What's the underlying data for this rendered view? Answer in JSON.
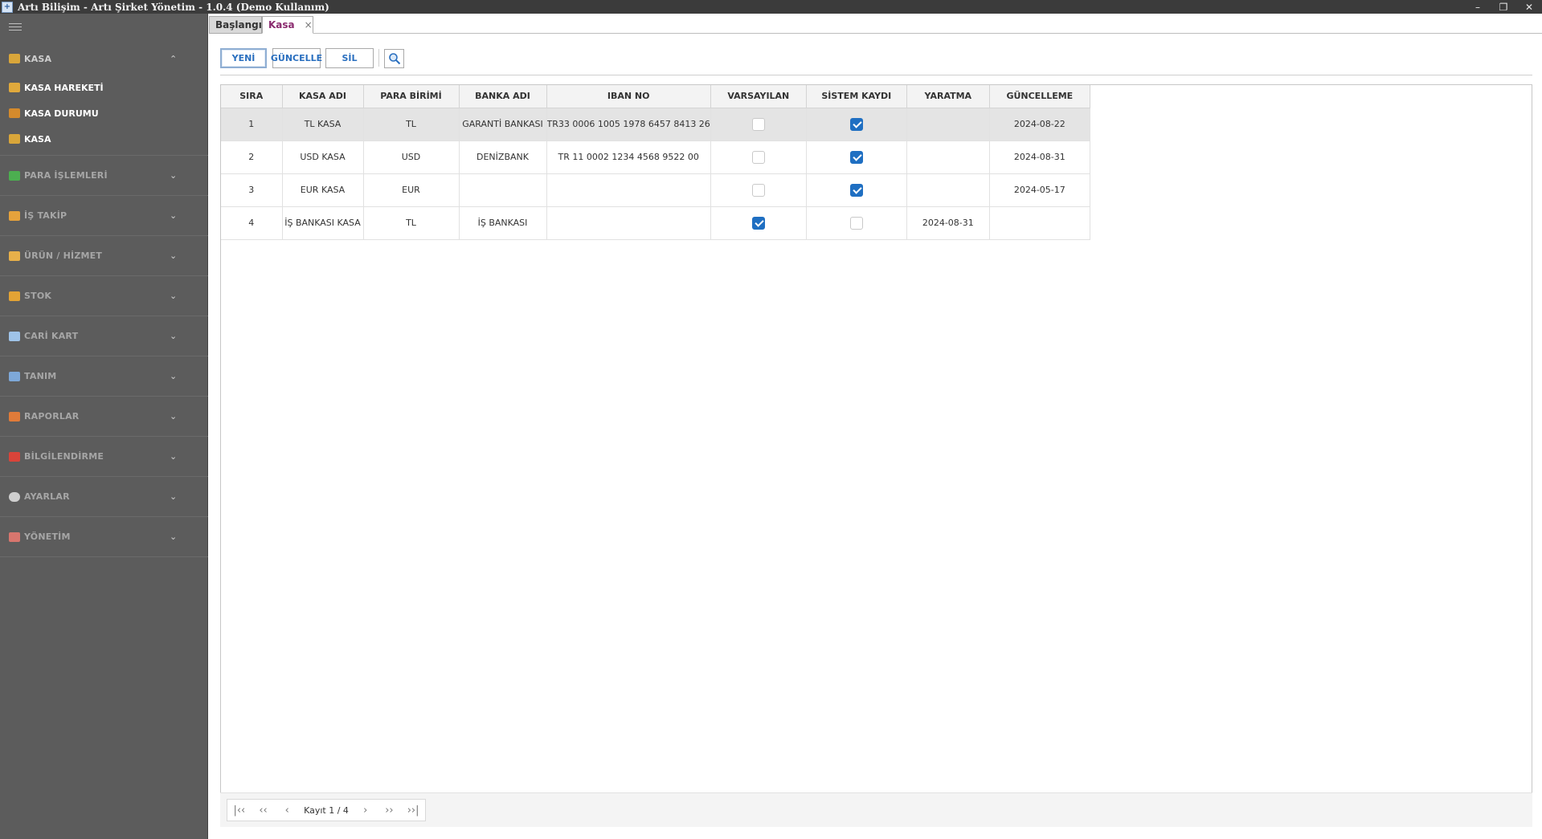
{
  "window": {
    "title": "Artı Bilişim - Artı Şirket Yönetim - 1.0.4 (Demo Kullanım)",
    "controls": {
      "minimize": "–",
      "restore": "❐",
      "close": "✕"
    }
  },
  "sidebar": {
    "sections": [
      {
        "label": "KASA",
        "icon": "cash-register-icon",
        "chevron": "⌃",
        "expanded": true,
        "items": [
          {
            "label": "KASA HAREKETİ",
            "icon": "cash-movement-icon"
          },
          {
            "label": "KASA DURUMU",
            "icon": "scale-icon"
          },
          {
            "label": "KASA",
            "icon": "cash-register-icon"
          }
        ]
      },
      {
        "label": "PARA İŞLEMLERİ",
        "icon": "money-icon",
        "chevron": "⌄"
      },
      {
        "label": "İŞ TAKİP",
        "icon": "pencil-icon",
        "chevron": "⌄"
      },
      {
        "label": "ÜRÜN / HİZMET",
        "icon": "box-icon",
        "chevron": "⌄"
      },
      {
        "label": "STOK",
        "icon": "boxes-icon",
        "chevron": "⌄"
      },
      {
        "label": "CARİ KART",
        "icon": "contact-card-icon",
        "chevron": "⌄"
      },
      {
        "label": "TANIM",
        "icon": "table-icon",
        "chevron": "⌄"
      },
      {
        "label": "RAPORLAR",
        "icon": "bar-chart-icon",
        "chevron": "⌄"
      },
      {
        "label": "BİLGİLENDİRME",
        "icon": "notification-icon",
        "chevron": "⌄"
      },
      {
        "label": "AYARLAR",
        "icon": "gear-icon",
        "chevron": "⌄"
      },
      {
        "label": "YÖNETİM",
        "icon": "admin-icon",
        "chevron": "⌄"
      }
    ]
  },
  "tabs": [
    {
      "label": "Başlangıç"
    },
    {
      "label": "Kasa",
      "close": "×"
    }
  ],
  "toolbar": {
    "new_label": "YENİ",
    "update_label": "GÜNCELLE",
    "delete_label": "SİL",
    "search_icon": "search-icon"
  },
  "grid": {
    "columns": [
      "SIRA",
      "KASA ADI",
      "PARA BİRİMİ",
      "BANKA ADI",
      "IBAN NO",
      "VARSAYILAN",
      "SİSTEM KAYDI",
      "YARATMA",
      "GÜNCELLEME"
    ],
    "rows": [
      {
        "sira": "1",
        "kasa_adi": "TL KASA",
        "para_birimi": "TL",
        "banka_adi": "GARANTİ BANKASI",
        "iban": "TR33 0006 1005 1978 6457 8413 26",
        "varsayilan": false,
        "sistem_kaydi": true,
        "yaratma": "",
        "guncelleme": "2024-08-22",
        "selected": true
      },
      {
        "sira": "2",
        "kasa_adi": "USD KASA",
        "para_birimi": "USD",
        "banka_adi": "DENİZBANK",
        "iban": "TR 11 0002 1234 4568 9522 00",
        "varsayilan": false,
        "sistem_kaydi": true,
        "yaratma": "",
        "guncelleme": "2024-08-31",
        "selected": false
      },
      {
        "sira": "3",
        "kasa_adi": "EUR KASA",
        "para_birimi": "EUR",
        "banka_adi": "",
        "iban": "",
        "varsayilan": false,
        "sistem_kaydi": true,
        "yaratma": "",
        "guncelleme": "2024-05-17",
        "selected": false
      },
      {
        "sira": "4",
        "kasa_adi": "İŞ BANKASI KASA",
        "para_birimi": "TL",
        "banka_adi": "İŞ BANKASI",
        "iban": "",
        "varsayilan": true,
        "sistem_kaydi": false,
        "yaratma": "2024-08-31",
        "guncelleme": "",
        "selected": false
      }
    ]
  },
  "pager": {
    "info": "Kayıt 1 / 4",
    "first": "|‹‹",
    "prev_page": "‹‹",
    "prev": "‹",
    "next": "›",
    "next_page": "››",
    "last": "››|"
  },
  "colors": {
    "sidebar_bg": "#5c5c5c",
    "accent_blue": "#1f6fc2",
    "active_tab": "#8a2a6e"
  }
}
